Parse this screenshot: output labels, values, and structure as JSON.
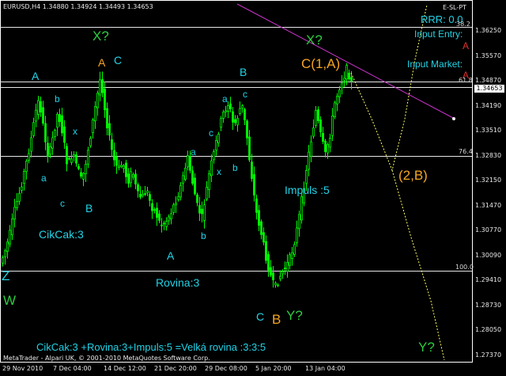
{
  "header": {
    "symbol_info": "EURUSD,H4",
    "ohlc": "1.34880 1.34924 1.34493 1.34653",
    "indicator": "E-SL-PT"
  },
  "trade_panel": {
    "rrr": "RRR: 0.0",
    "input_entry": "Input Entry:",
    "input_market": "Input Market:",
    "arrow_a1": "A",
    "arrow_a2": "A"
  },
  "price_axis": [
    "1.36250",
    "1.35570",
    "1.34870",
    "1.34190",
    "1.33510",
    "1.32830",
    "1.32150",
    "1.31470",
    "1.30770",
    "1.30090",
    "1.29410",
    "1.28730",
    "1.28050",
    "1.27370"
  ],
  "current_price": "1.34653",
  "fib_levels": {
    "top": "38.2",
    "l618": "61.8",
    "l764": "76.4",
    "l100": "100.0"
  },
  "time_axis": [
    "29 Nov 2010",
    "7 Dec 04:00",
    "14 Dec 12:00",
    "21 Dec 20:00",
    "29 Dec 08:00",
    "5 Jan 20:00",
    "13 Jan 04:00"
  ],
  "wave_labels": {
    "z": "Z",
    "w": "W",
    "a_big1": "A",
    "a_small1": "a",
    "b_small1": "b",
    "x_small1": "x",
    "c_small1": "c",
    "b_big1": "B",
    "cikcak": "CikCak:3",
    "a_orange": "A",
    "c_cyan1": "C",
    "x_q1": "X?",
    "a_big2": "A",
    "b_small2": "b",
    "a_small2": "a",
    "c_small2": "c",
    "x_small2": "x",
    "b_small3": "b",
    "a_small3": "a",
    "c_small3": "c",
    "b_big2": "B",
    "rovina": "Rovina:3",
    "c_big3": "C",
    "b_orange": "B",
    "y_q1": "Y?",
    "impuls": "Impuls :5",
    "x_q2": "X?",
    "c1a": "C(1,A)",
    "two_b": "(2,B)",
    "y_q2": "Y?"
  },
  "footer": {
    "formula": "CikCak:3 +Rovina:3+Impuls:5 =Velká rovina :3:3:5",
    "copyright": "MetaTrader - Alpari UK, © 2001-2010 MetaQuotes Software Corp."
  },
  "colors": {
    "bull": "#00ff00",
    "bear": "#00ff00",
    "grid": "#ffffff",
    "trend": "#cc33cc",
    "projection": "#ffff66"
  }
}
